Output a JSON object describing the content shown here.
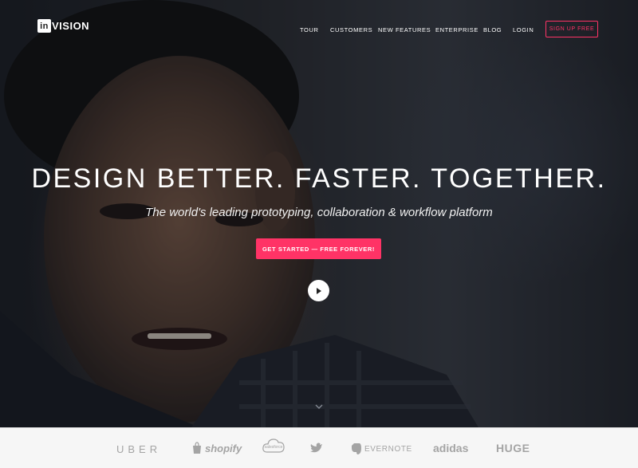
{
  "brand": {
    "logo_prefix": "in",
    "logo_suffix": "VISION"
  },
  "nav": {
    "items": [
      {
        "label": "TOUR"
      },
      {
        "label": "CUSTOMERS"
      },
      {
        "label": "NEW FEATURES"
      },
      {
        "label": "ENTERPRISE"
      },
      {
        "label": "BLOG"
      },
      {
        "label": "LOGIN"
      }
    ],
    "signup_label": "SIGN UP FREE"
  },
  "hero": {
    "headline": "DESIGN BETTER. FASTER. TOGETHER.",
    "subhead": "The world's leading prototyping, collaboration & workflow platform",
    "cta_label": "GET STARTED — FREE FOREVER!"
  },
  "clients": {
    "uber": "UBER",
    "shopify": "shopify",
    "salesforce": "salesforce",
    "evernote": "EVERNOTE",
    "adidas": "adidas",
    "huge": "HUGE"
  },
  "colors": {
    "accent": "#ff3366",
    "strip_bg": "#f6f6f6",
    "client_logo": "#a4a4a4"
  },
  "icons": {
    "play": "play-icon",
    "scroll": "chevron-down-icon",
    "shopify_bag": "shopping-bag-icon",
    "salesforce_cloud": "cloud-icon",
    "twitter_bird": "bird-icon",
    "evernote_elephant": "elephant-icon"
  }
}
